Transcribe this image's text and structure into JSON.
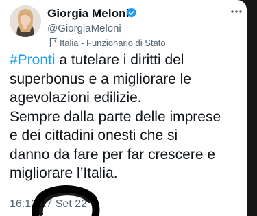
{
  "tweet": {
    "author": {
      "display_name": "Giorgia Meloni",
      "handle": "@GiorgiaMeloni",
      "verified_icon": "verified-badge-icon",
      "avatar": "profile-photo"
    },
    "label": {
      "icon": "flag-icon",
      "text": "Italia - Funzionario di Stato"
    },
    "more_icon": "more-options-icon",
    "hashtag": "#Pronti",
    "text_lines": [
      " a tutelare i diritti del",
      "superbonus e a migliorare le",
      "agevolazioni edilizie.",
      "Sempre dalla parte delle imprese",
      "e dei cittadini onesti che si",
      "danno da fare per far crescere e",
      "migliorare l’Italia."
    ],
    "time": "16:13",
    "date": "17 Set 22",
    "colors": {
      "hashtag": "#1d9bf0",
      "verified": "#1d9bf0",
      "text": "#0f1419",
      "secondary": "#536471",
      "scribble": "#000000"
    }
  }
}
